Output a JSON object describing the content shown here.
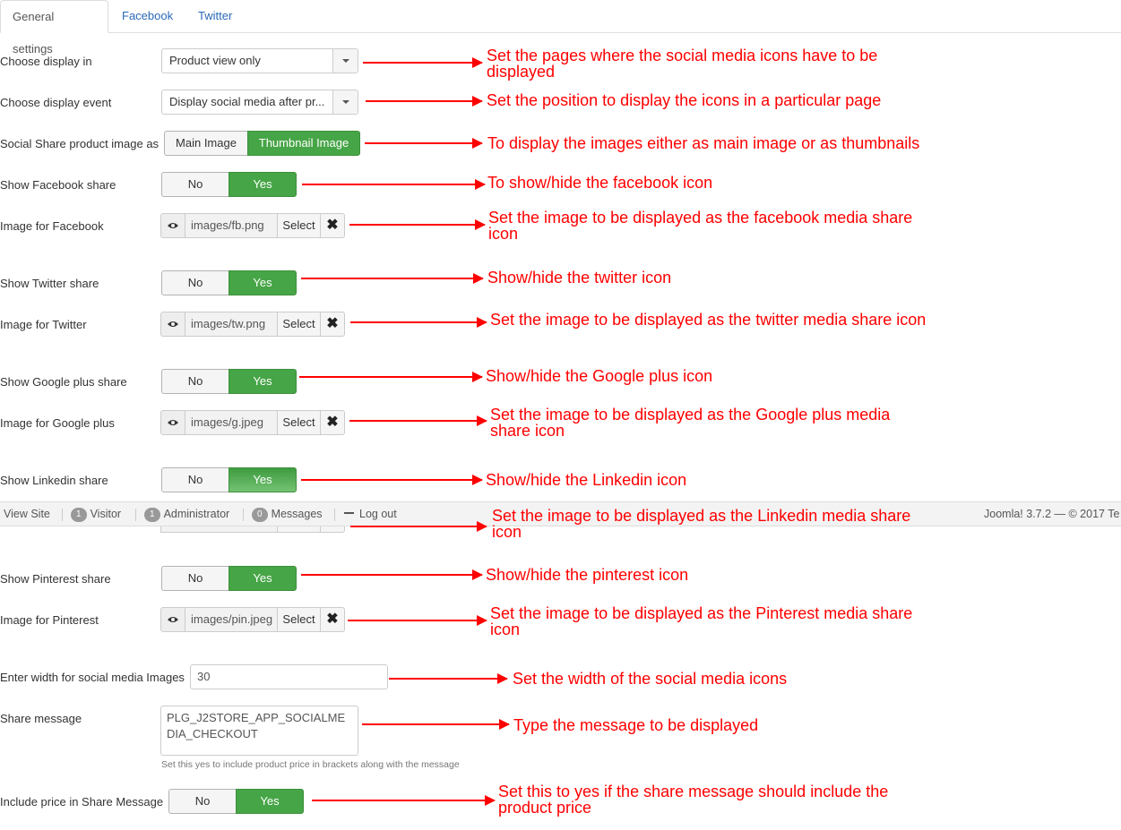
{
  "tabs": [
    {
      "label": "General settings",
      "active": true
    },
    {
      "label": "Facebook",
      "active": false
    },
    {
      "label": "Twitter",
      "active": false
    }
  ],
  "fields": {
    "display_in": {
      "label": "Choose display in",
      "value": "Product view only"
    },
    "display_event": {
      "label": "Choose display event",
      "value": "Display social media after pr..."
    },
    "share_image": {
      "label": "Social Share product image as",
      "options": [
        "Main Image",
        "Thumbnail Image"
      ],
      "selected": "Thumbnail Image"
    },
    "show_facebook": {
      "label": "Show Facebook share",
      "no": "No",
      "yes": "Yes",
      "selected": "Yes"
    },
    "image_facebook": {
      "label": "Image for Facebook",
      "path": "images/fb.png",
      "select": "Select"
    },
    "show_twitter": {
      "label": "Show Twitter share",
      "no": "No",
      "yes": "Yes",
      "selected": "Yes"
    },
    "image_twitter": {
      "label": "Image for Twitter",
      "path": "images/tw.png",
      "select": "Select"
    },
    "show_google": {
      "label": "Show Google plus share",
      "no": "No",
      "yes": "Yes",
      "selected": "Yes"
    },
    "image_google": {
      "label": "Image for Google plus",
      "path": "images/g.jpeg",
      "select": "Select"
    },
    "show_linkedin": {
      "label": "Show Linkedin share",
      "no": "No",
      "yes": "Yes",
      "selected": "Yes"
    },
    "show_pinterest": {
      "label": "Show Pinterest share",
      "no": "No",
      "yes": "Yes",
      "selected": "Yes"
    },
    "image_pinterest": {
      "label": "Image for Pinterest",
      "path": "images/pin.jpeg",
      "select": "Select"
    },
    "image_width": {
      "label": "Enter width for social media Images",
      "value": "30"
    },
    "share_message": {
      "label": "Share message",
      "value": "PLG_J2STORE_APP_SOCIALMEDIA_CHECKOUT",
      "help": "Set this yes to include product price in brackets along with the message"
    },
    "include_price": {
      "label": "Include price in Share Message",
      "no": "No",
      "yes": "Yes",
      "selected": "Yes"
    }
  },
  "statusbar": {
    "view_site": "View Site",
    "visitor_count": "1",
    "visitor_label": "Visitor",
    "admin_count": "1",
    "admin_label": "Administrator",
    "messages_count": "0",
    "messages_label": "Messages",
    "logout": "Log out",
    "version": "Joomla! 3.7.2 — © 2017 Te"
  },
  "annotations": {
    "display_in": "Set the pages where the social media icons have to be displayed",
    "display_event": "Set the position to display the icons in a particular page",
    "share_image": "To display the images either as main image or as thumbnails",
    "show_facebook": "To show/hide the facebook icon",
    "image_facebook": "Set the image to be displayed as the facebook media share icon",
    "show_twitter": "Show/hide the twitter icon",
    "image_twitter": "Set the image to be displayed as the twitter media share icon",
    "show_google": "Show/hide the Google plus icon",
    "image_google": "Set the image to be displayed as the Google plus media share icon",
    "show_linkedin": "Show/hide the Linkedin icon",
    "image_linkedin": "Set the image to be displayed as the Linkedin media share icon",
    "show_pinterest": "Show/hide the pinterest icon",
    "image_pinterest": "Set the image to be displayed as the Pinterest media share icon",
    "image_width": "Set the width of the social media icons",
    "share_message": "Type the message to be displayed",
    "include_price": "Set this to yes if the share message should include the product price"
  },
  "colors": {
    "annotation": "#ff0000",
    "toggle_on": "#46a546",
    "link": "#2a69b8"
  }
}
